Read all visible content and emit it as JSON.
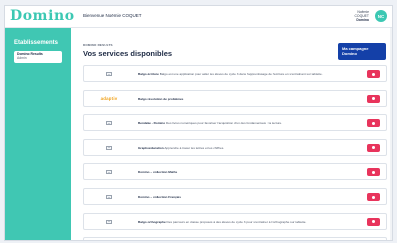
{
  "app": {
    "logo": "Domino",
    "welcome": "Bienvenue Noëmie COQUET",
    "user_line1": "Noëmie",
    "user_line2": "COQUET",
    "user_line3": "Domino",
    "avatar_initials": "NC"
  },
  "sidebar": {
    "title": "Etablissements",
    "items": [
      {
        "line1": "Domino Results",
        "line2": "Admin"
      }
    ]
  },
  "main": {
    "breadcrumb": "DOMINO RESULTS",
    "title": "Vos services disponibles",
    "campaign_button_line1": "Ma campagne",
    "campaign_button_line2": "Domino"
  },
  "services": [
    {
      "logo_type": "image",
      "title": "Balgo écriture",
      "description": "Balgo est une application pour aider les élèves de cycle 3 dans l'apprentissage de l'écriture en s'entraînant sur tablette."
    },
    {
      "logo_type": "brand",
      "brand": "adaptiv",
      "title": "Balgo résolution de problèmes",
      "description": ""
    },
    {
      "logo_type": "image",
      "title": "Bendeke - Domino",
      "description": "Des livres numériques pour favoriser l'acquisition d'un des fondamentaux : la lecture."
    },
    {
      "logo_type": "image",
      "title": "Graphoéducation",
      "description": "Apprendre à tracer les lettres et les chiffres."
    },
    {
      "logo_type": "image",
      "title": "Domino – collection Maths",
      "description": ""
    },
    {
      "logo_type": "image",
      "title": "Domino – collection Français",
      "description": ""
    },
    {
      "logo_type": "image",
      "title": "Balgo orthographe",
      "description": "Des parcours en classe proposés à des élèves de cycle 3 pour s'entraîner à l'orthographe sur tablette."
    },
    {
      "logo_type": "image",
      "title": "Calculeux",
      "description": "Une manière ludique et pratique pour l'apprentissage de la numération."
    }
  ],
  "colors": {
    "accent": "#40c7b3",
    "primary_button": "#1440a8",
    "toggle": "#e8345c"
  }
}
